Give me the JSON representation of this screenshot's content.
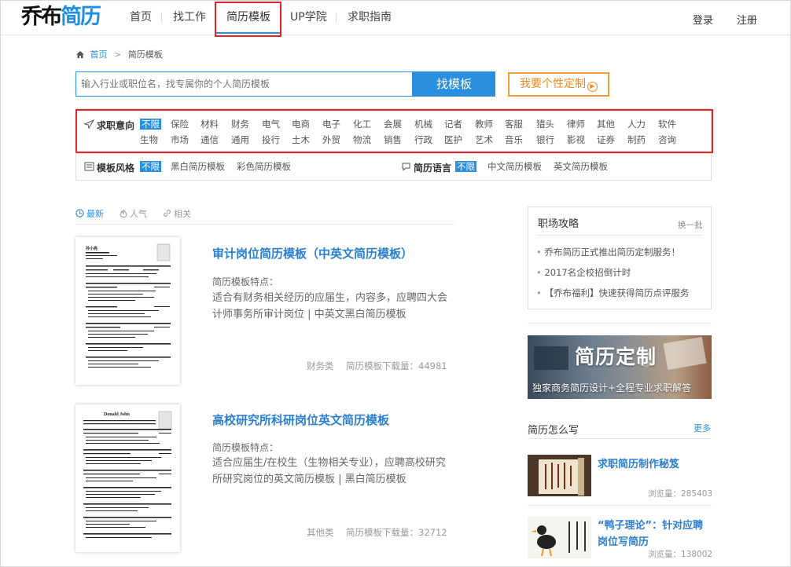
{
  "logo": {
    "part1": "乔布",
    "part2": "简历"
  },
  "nav": {
    "items": [
      "首页",
      "找工作",
      "简历模板",
      "UP学院",
      "求职指南"
    ],
    "login": "登录",
    "register": "注册"
  },
  "breadcrumb": {
    "home": "首页",
    "sep": ">",
    "current": "简历模板"
  },
  "search": {
    "placeholder": "输入行业或职位名，找专属你的个人简历模板",
    "button": "找模板"
  },
  "custom": {
    "label": "我要个性定制",
    "arrow": "▶"
  },
  "filters": {
    "intent_label": "求职意向",
    "row1": [
      "不限",
      "保险",
      "材料",
      "财务",
      "电气",
      "电商",
      "电子",
      "化工",
      "会展",
      "机械",
      "记者",
      "教师",
      "客服",
      "猎头",
      "律师",
      "其他",
      "人力",
      "软件"
    ],
    "row2": [
      "生物",
      "市场",
      "通信",
      "通用",
      "投行",
      "土木",
      "外贸",
      "物流",
      "销售",
      "行政",
      "医护",
      "艺术",
      "音乐",
      "银行",
      "影视",
      "证券",
      "制药",
      "咨询"
    ],
    "style_label": "模板风格",
    "style_options": [
      "不限",
      "黑白简历模板",
      "彩色简历模板"
    ],
    "lang_label": "简历语言",
    "lang_options": [
      "不限",
      "中文简历模板",
      "英文简历模板"
    ]
  },
  "tabs": {
    "latest": "最新",
    "popular": "人气",
    "related": "相关"
  },
  "templates": [
    {
      "title": "审计岗位简历模板（中英文简历模板）",
      "label": "简历模板特点：",
      "desc": "适合有财务相关经历的应届生，内容多，应聘四大会计师事务所审计岗位 | 中英文黑白简历模板",
      "category": "财务类",
      "downloads": "简历模板下载量：44981",
      "thumb_name": "孙小亮"
    },
    {
      "title": "高校研究所科研岗位英文简历模板",
      "label": "简历模板特点：",
      "desc": "适合应届生/在校生（生物相关专业），应聘高校研究所研究岗位的英文简历模板 | 黑白简历模板",
      "category": "其他类",
      "downloads": "简历模板下载量：32712",
      "thumb_name": "Donald John"
    }
  ],
  "sidebar": {
    "tips_title": "职场攻略",
    "tips_more": "换一批",
    "tips": [
      "乔布简历正式推出简历定制服务！",
      "2017名企校招倒计时",
      "【乔布福利】快速获得简历点评服务"
    ],
    "banner_title": "简历定制",
    "banner_sub": "独家商务简历设计+全程专业求职解答",
    "how_title": "简历怎么写",
    "how_more": "更多",
    "articles": [
      {
        "title": "求职简历制作秘笈",
        "views": "浏览量：285403"
      },
      {
        "title": "“鸭子理论”：针对应聘岗位写简历",
        "views": "浏览量：138002"
      }
    ]
  },
  "colors": {
    "accent": "#2b8fe0",
    "title": "#2b7fcf",
    "orange": "#f08a18",
    "highlight": "#e2232a"
  }
}
